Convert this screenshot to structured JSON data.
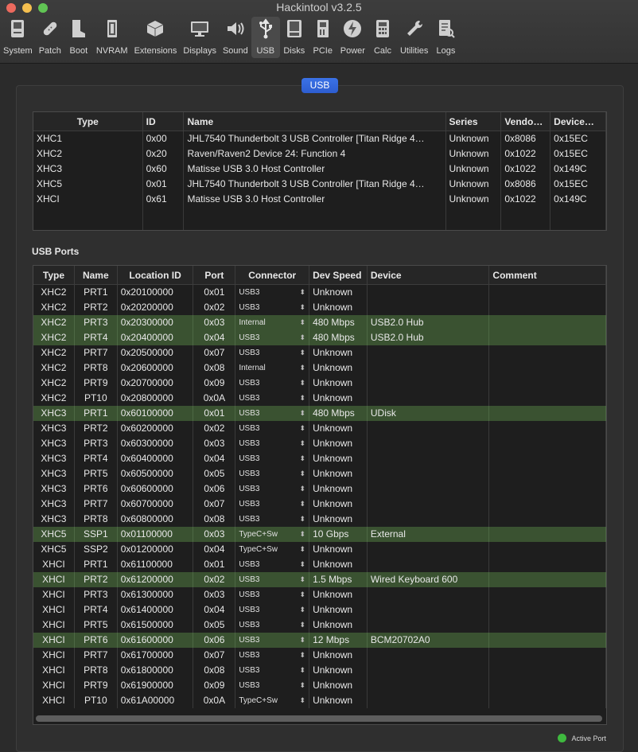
{
  "window": {
    "title": "Hackintool v3.2.5"
  },
  "toolbar": [
    {
      "label": "System",
      "icon": "system-icon"
    },
    {
      "label": "Patch",
      "icon": "patch-icon"
    },
    {
      "label": "Boot",
      "icon": "boot-icon"
    },
    {
      "label": "NVRAM",
      "icon": "nvram-icon"
    },
    {
      "label": "Extensions",
      "icon": "extensions-icon"
    },
    {
      "label": "Displays",
      "icon": "displays-icon"
    },
    {
      "label": "Sound",
      "icon": "sound-icon"
    },
    {
      "label": "USB",
      "icon": "usb-icon",
      "active": true
    },
    {
      "label": "Disks",
      "icon": "disks-icon"
    },
    {
      "label": "PCIe",
      "icon": "pcie-icon"
    },
    {
      "label": "Power",
      "icon": "power-icon"
    },
    {
      "label": "Calc",
      "icon": "calc-icon"
    },
    {
      "label": "Utilities",
      "icon": "utilities-icon"
    },
    {
      "label": "Logs",
      "icon": "logs-icon"
    }
  ],
  "tab": {
    "label": "USB"
  },
  "controllers": {
    "columns": [
      "Type",
      "ID",
      "Name",
      "Series",
      "Vendo…",
      "Device…"
    ],
    "rows": [
      [
        "XHC1",
        "0x00",
        "JHL7540 Thunderbolt 3 USB Controller [Titan Ridge 4…",
        "Unknown",
        "0x8086",
        "0x15EC"
      ],
      [
        "XHC2",
        "0x20",
        "Raven/Raven2 Device 24: Function 4",
        "Unknown",
        "0x1022",
        "0x15EC"
      ],
      [
        "XHC3",
        "0x60",
        "Matisse USB 3.0 Host Controller",
        "Unknown",
        "0x1022",
        "0x149C"
      ],
      [
        "XHC5",
        "0x01",
        "JHL7540 Thunderbolt 3 USB Controller [Titan Ridge 4…",
        "Unknown",
        "0x8086",
        "0x15EC"
      ],
      [
        "XHCI",
        "0x61",
        "Matisse USB 3.0 Host Controller",
        "Unknown",
        "0x1022",
        "0x149C"
      ]
    ]
  },
  "ports": {
    "title": "USB Ports",
    "columns": [
      "Type",
      "Name",
      "Location ID",
      "Port",
      "Connector",
      "Dev Speed",
      "Device",
      "Comment"
    ],
    "rows": [
      {
        "type": "XHC2",
        "name": "PRT1",
        "loc": "0x20100000",
        "port": "0x01",
        "conn": "USB3",
        "speed": "Unknown",
        "device": "",
        "comment": "",
        "active": false
      },
      {
        "type": "XHC2",
        "name": "PRT2",
        "loc": "0x20200000",
        "port": "0x02",
        "conn": "USB3",
        "speed": "Unknown",
        "device": "",
        "comment": "",
        "active": false
      },
      {
        "type": "XHC2",
        "name": "PRT3",
        "loc": "0x20300000",
        "port": "0x03",
        "conn": "Internal",
        "speed": "480 Mbps",
        "device": "USB2.0 Hub",
        "comment": "",
        "active": true
      },
      {
        "type": "XHC2",
        "name": "PRT4",
        "loc": "0x20400000",
        "port": "0x04",
        "conn": "USB3",
        "speed": "480 Mbps",
        "device": "USB2.0 Hub",
        "comment": "",
        "active": true
      },
      {
        "type": "XHC2",
        "name": "PRT7",
        "loc": "0x20500000",
        "port": "0x07",
        "conn": "USB3",
        "speed": "Unknown",
        "device": "",
        "comment": "",
        "active": false
      },
      {
        "type": "XHC2",
        "name": "PRT8",
        "loc": "0x20600000",
        "port": "0x08",
        "conn": "Internal",
        "speed": "Unknown",
        "device": "",
        "comment": "",
        "active": false
      },
      {
        "type": "XHC2",
        "name": "PRT9",
        "loc": "0x20700000",
        "port": "0x09",
        "conn": "USB3",
        "speed": "Unknown",
        "device": "",
        "comment": "",
        "active": false
      },
      {
        "type": "XHC2",
        "name": "PT10",
        "loc": "0x20800000",
        "port": "0x0A",
        "conn": "USB3",
        "speed": "Unknown",
        "device": "",
        "comment": "",
        "active": false
      },
      {
        "type": "XHC3",
        "name": "PRT1",
        "loc": "0x60100000",
        "port": "0x01",
        "conn": "USB3",
        "speed": "480 Mbps",
        "device": "UDisk",
        "comment": "",
        "active": true
      },
      {
        "type": "XHC3",
        "name": "PRT2",
        "loc": "0x60200000",
        "port": "0x02",
        "conn": "USB3",
        "speed": "Unknown",
        "device": "",
        "comment": "",
        "active": false
      },
      {
        "type": "XHC3",
        "name": "PRT3",
        "loc": "0x60300000",
        "port": "0x03",
        "conn": "USB3",
        "speed": "Unknown",
        "device": "",
        "comment": "",
        "active": false
      },
      {
        "type": "XHC3",
        "name": "PRT4",
        "loc": "0x60400000",
        "port": "0x04",
        "conn": "USB3",
        "speed": "Unknown",
        "device": "",
        "comment": "",
        "active": false
      },
      {
        "type": "XHC3",
        "name": "PRT5",
        "loc": "0x60500000",
        "port": "0x05",
        "conn": "USB3",
        "speed": "Unknown",
        "device": "",
        "comment": "",
        "active": false
      },
      {
        "type": "XHC3",
        "name": "PRT6",
        "loc": "0x60600000",
        "port": "0x06",
        "conn": "USB3",
        "speed": "Unknown",
        "device": "",
        "comment": "",
        "active": false
      },
      {
        "type": "XHC3",
        "name": "PRT7",
        "loc": "0x60700000",
        "port": "0x07",
        "conn": "USB3",
        "speed": "Unknown",
        "device": "",
        "comment": "",
        "active": false
      },
      {
        "type": "XHC3",
        "name": "PRT8",
        "loc": "0x60800000",
        "port": "0x08",
        "conn": "USB3",
        "speed": "Unknown",
        "device": "",
        "comment": "",
        "active": false
      },
      {
        "type": "XHC5",
        "name": "SSP1",
        "loc": "0x01100000",
        "port": "0x03",
        "conn": "TypeC+Sw",
        "speed": "10 Gbps",
        "device": "External",
        "comment": "",
        "active": true
      },
      {
        "type": "XHC5",
        "name": "SSP2",
        "loc": "0x01200000",
        "port": "0x04",
        "conn": "TypeC+Sw",
        "speed": "Unknown",
        "device": "",
        "comment": "",
        "active": false
      },
      {
        "type": "XHCI",
        "name": "PRT1",
        "loc": "0x61100000",
        "port": "0x01",
        "conn": "USB3",
        "speed": "Unknown",
        "device": "",
        "comment": "",
        "active": false
      },
      {
        "type": "XHCI",
        "name": "PRT2",
        "loc": "0x61200000",
        "port": "0x02",
        "conn": "USB3",
        "speed": "1.5 Mbps",
        "device": "Wired Keyboard 600",
        "comment": "",
        "active": true
      },
      {
        "type": "XHCI",
        "name": "PRT3",
        "loc": "0x61300000",
        "port": "0x03",
        "conn": "USB3",
        "speed": "Unknown",
        "device": "",
        "comment": "",
        "active": false
      },
      {
        "type": "XHCI",
        "name": "PRT4",
        "loc": "0x61400000",
        "port": "0x04",
        "conn": "USB3",
        "speed": "Unknown",
        "device": "",
        "comment": "",
        "active": false
      },
      {
        "type": "XHCI",
        "name": "PRT5",
        "loc": "0x61500000",
        "port": "0x05",
        "conn": "USB3",
        "speed": "Unknown",
        "device": "",
        "comment": "",
        "active": false
      },
      {
        "type": "XHCI",
        "name": "PRT6",
        "loc": "0x61600000",
        "port": "0x06",
        "conn": "USB3",
        "speed": "12 Mbps",
        "device": "BCM20702A0",
        "comment": "",
        "active": true
      },
      {
        "type": "XHCI",
        "name": "PRT7",
        "loc": "0x61700000",
        "port": "0x07",
        "conn": "USB3",
        "speed": "Unknown",
        "device": "",
        "comment": "",
        "active": false
      },
      {
        "type": "XHCI",
        "name": "PRT8",
        "loc": "0x61800000",
        "port": "0x08",
        "conn": "USB3",
        "speed": "Unknown",
        "device": "",
        "comment": "",
        "active": false
      },
      {
        "type": "XHCI",
        "name": "PRT9",
        "loc": "0x61900000",
        "port": "0x09",
        "conn": "USB3",
        "speed": "Unknown",
        "device": "",
        "comment": "",
        "active": false
      },
      {
        "type": "XHCI",
        "name": "PT10",
        "loc": "0x61A00000",
        "port": "0x0A",
        "conn": "TypeC+Sw",
        "speed": "Unknown",
        "device": "",
        "comment": "",
        "active": false
      }
    ]
  },
  "legend": {
    "label": "Active Port",
    "color": "#3fb93f"
  },
  "colors": {
    "active_row": "#3a5231",
    "tab_accent": "#2d5dd0"
  }
}
